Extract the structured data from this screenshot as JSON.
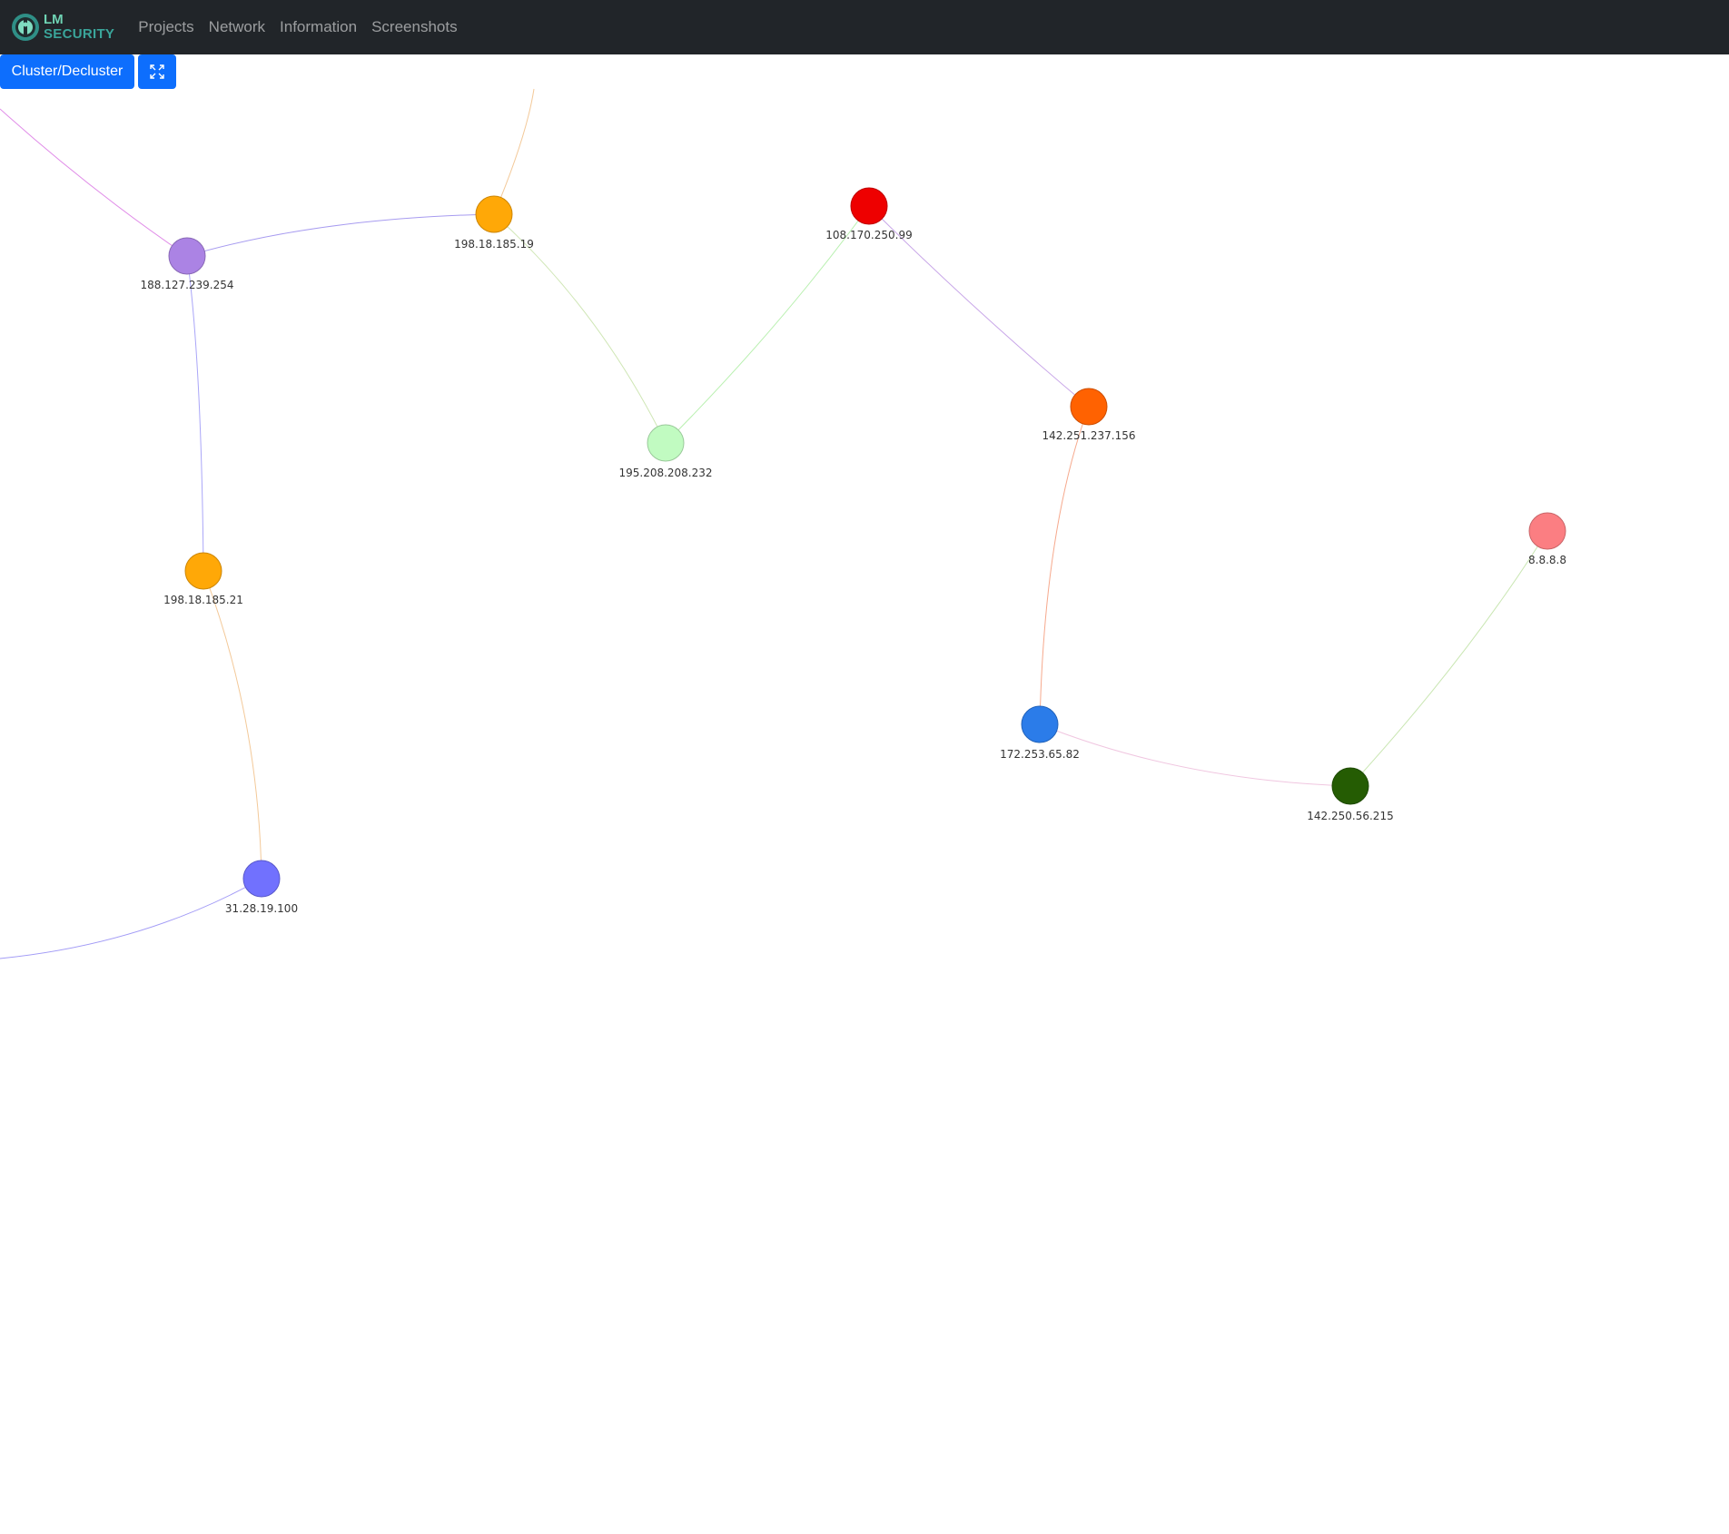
{
  "brand": {
    "line1": "LM",
    "line2": "SECURITY"
  },
  "nav": {
    "items": [
      {
        "label": "Projects"
      },
      {
        "label": "Network"
      },
      {
        "label": "Information"
      },
      {
        "label": "Screenshots"
      }
    ]
  },
  "toolbar": {
    "cluster_label": "Cluster/Decluster",
    "fullscreen_icon": "fullscreen-icon"
  },
  "graph": {
    "nodes": [
      {
        "id": "n1",
        "label": "188.127.239.254",
        "color": "#ab83e4"
      },
      {
        "id": "n2",
        "label": "198.18.185.19",
        "color": "#ffa807"
      },
      {
        "id": "n3",
        "label": "108.170.250.99",
        "color": "#ee0000"
      },
      {
        "id": "n4",
        "label": "195.208.208.232",
        "color": "#c1fbc1"
      },
      {
        "id": "n5",
        "label": "142.251.237.156",
        "color": "#ff6201"
      },
      {
        "id": "n6",
        "label": "8.8.8.8",
        "color": "#fb7e82"
      },
      {
        "id": "n7",
        "label": "198.18.185.21",
        "color": "#ffa807"
      },
      {
        "id": "n8",
        "label": "172.253.65.82",
        "color": "#2b7ce9"
      },
      {
        "id": "n9",
        "label": "142.250.56.215",
        "color": "#255c03"
      },
      {
        "id": "n10",
        "label": "31.28.19.100",
        "color": "#7171fe"
      }
    ],
    "edges": [
      {
        "from": "offscreen-a",
        "to": "n1",
        "color": "#e08ce8"
      },
      {
        "from": "offscreen-b",
        "to": "n2",
        "color": "#f3c999"
      },
      {
        "from": "n1",
        "to": "n2",
        "color": "#a79bf0"
      },
      {
        "from": "n1",
        "to": "n7",
        "color": "#aaa6f8"
      },
      {
        "from": "n2",
        "to": "n4",
        "color": "#cfe6b5"
      },
      {
        "from": "n3",
        "to": "n4",
        "color": "#b9f0b0"
      },
      {
        "from": "n3",
        "to": "n5",
        "color": "#c8a6e8"
      },
      {
        "from": "n5",
        "to": "n8",
        "color": "#f6a98d"
      },
      {
        "from": "n8",
        "to": "n9",
        "color": "#f0c6e0"
      },
      {
        "from": "n6",
        "to": "n9",
        "color": "#c9e6b2"
      },
      {
        "from": "n7",
        "to": "n10",
        "color": "#f3c999"
      },
      {
        "from": "n10",
        "to": "offscreen-c",
        "color": "#a29bf6"
      }
    ]
  }
}
